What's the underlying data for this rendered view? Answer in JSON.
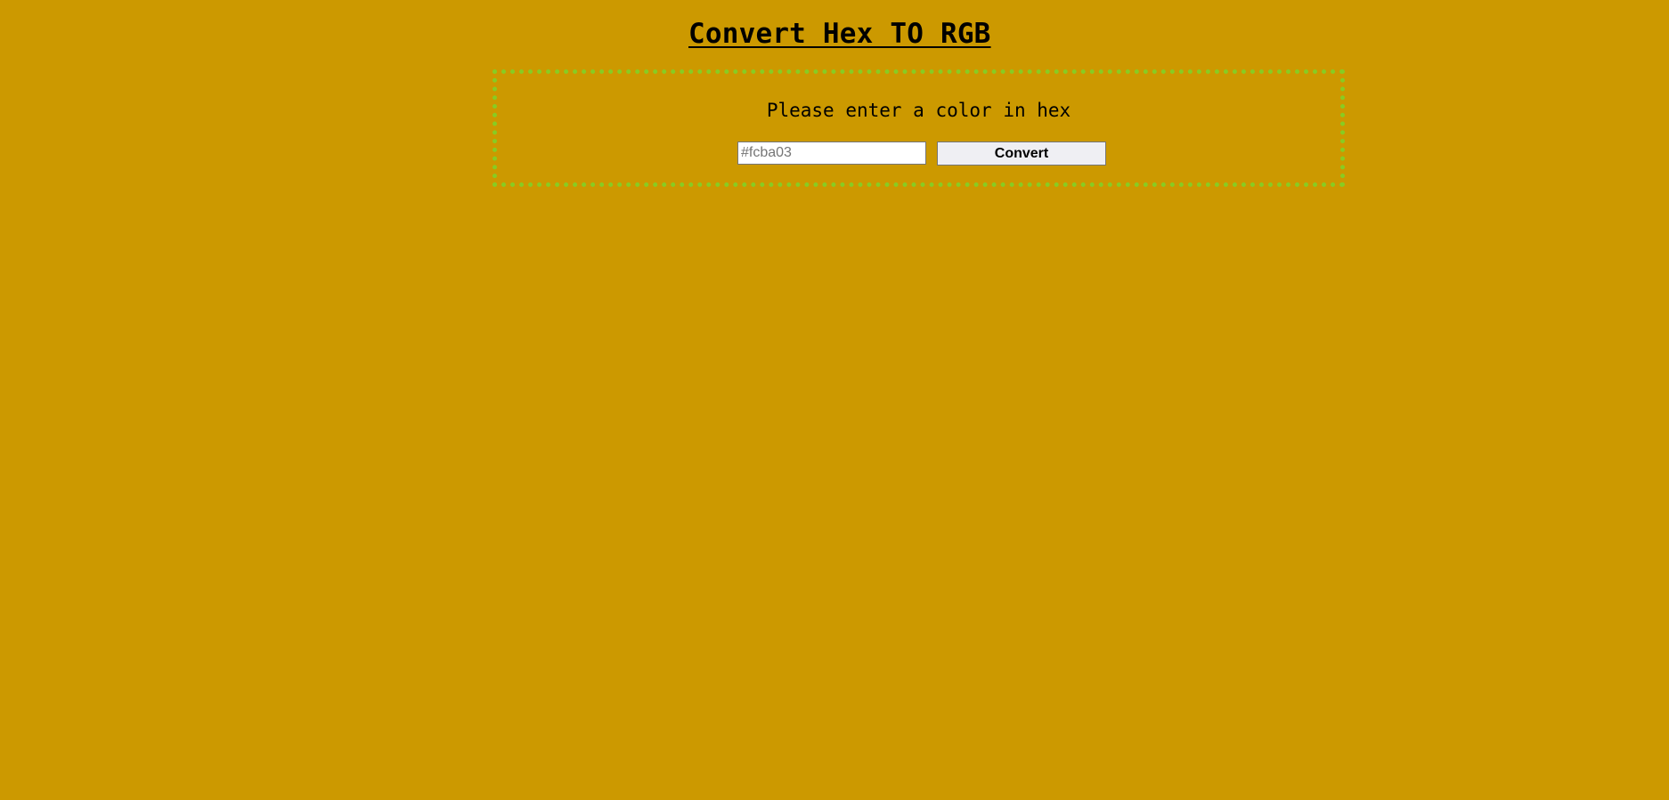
{
  "page": {
    "title": "Convert Hex TO RGB",
    "background_color": "#cc9900"
  },
  "converter": {
    "border_color": "#88cc22",
    "prompt": "Please enter a color in hex",
    "input_value": "",
    "input_placeholder": "#fcba03",
    "button_label": "Convert"
  }
}
